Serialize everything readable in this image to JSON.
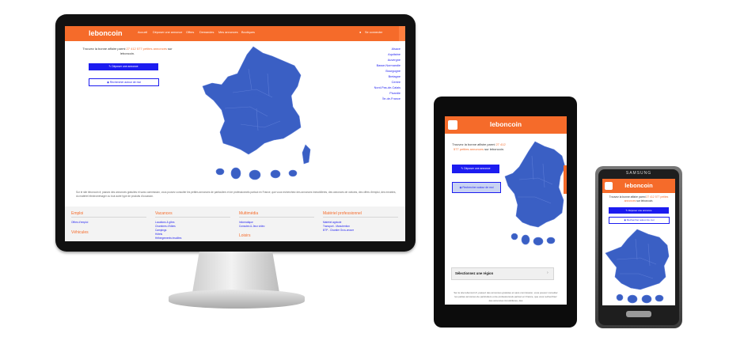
{
  "brand": {
    "logo": "leboncoin",
    "accent": "#f56b2a",
    "link_blue": "#1c1cf0",
    "map_blue": "#3a5fc4"
  },
  "desktop": {
    "nav": [
      "Accueil",
      "Déposer une annonce",
      "Offres",
      "Demandes",
      "Mes annonces",
      "Boutiques"
    ],
    "account": "Se connecter",
    "intro_before": "Trouvez la bonne affaire parmi",
    "intro_highlight": "27 412 577 petites annonces",
    "intro_after": "sur leboncoin.",
    "post_button": "Déposer une annonce",
    "around_button": "Rechercher autour de moi",
    "regions": [
      "Alsace",
      "Aquitaine",
      "Auvergne",
      "Basse-Normandie",
      "Bourgogne",
      "Bretagne",
      "Centre",
      "Nord-Pas-de-Calais",
      "Picardie",
      "Île-de-France"
    ],
    "footer_text": "Sur le site leboncoin.fr, passez des annonces gratuites et sans commission, vous pouvez consulter les petites annonces de particuliers et de professionnels partout en France, que vous recherchiez des annonces immobilières, des annonces de voitures, des offres d'emploi, des meubles, du matériel électroménager ou tout autre type de produits d'occasion.",
    "categories": [
      {
        "title": "Emploi",
        "links": [
          "Offres d'emploi"
        ]
      },
      {
        "title": "Véhicules",
        "links": []
      },
      {
        "title": "Vacances",
        "links": [
          "Locations & gîtes",
          "Chambres d'hôtes",
          "Campings",
          "Hôtels",
          "Hébergements insolites"
        ]
      },
      {
        "title": "Multimédia",
        "links": [
          "Informatique",
          "Consoles & Jeux vidéo"
        ]
      },
      {
        "title": "Loisirs",
        "links": []
      },
      {
        "title": "Matériel professionnel",
        "links": [
          "Matériel agricole",
          "Transport - Manutention",
          "BTP - Chantier Gros-œuvre"
        ]
      }
    ]
  },
  "tablet": {
    "logo": "leboncoin",
    "intro_before": "Trouvez la bonne affaire parmi",
    "intro_highlight": "27 412 577 petites annonces",
    "intro_after": "sur leboncoin.",
    "post_button": "Déposer une annonce",
    "around_button": "Rechercher autour de moi",
    "region_select": "Sélectionnez une région",
    "chevron": "›",
    "footer_text": "Sur le site leboncoin.fr, passez des annonces gratuites et sans commission, vous pouvez consulter les petites annonces de particuliers et de professionnels partout en France, que vous recherchiez des annonces immobilières, des"
  },
  "phone": {
    "brand": "SAMSUNG",
    "logo": "leboncoin",
    "intro_before": "Trouvez la bonne affaire parmi",
    "intro_highlight": "27 412 577 petites annonces",
    "intro_after": "sur leboncoin.",
    "post_button": "Déposer une annonce",
    "around_button": "Rechercher autour de moi"
  }
}
